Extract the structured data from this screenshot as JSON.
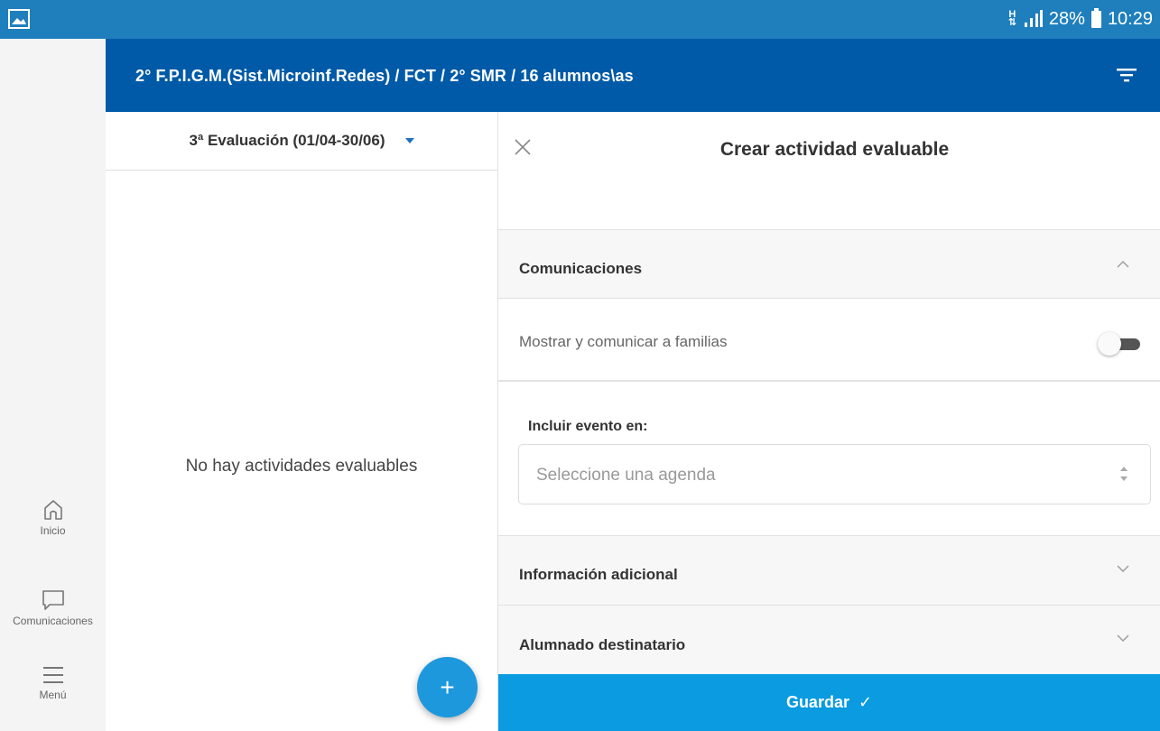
{
  "status_bar": {
    "network_type": "H",
    "battery_percent": "28%",
    "time": "10:29"
  },
  "header": {
    "title": "2° F.P.I.G.M.(Sist.Microinf.Redes) / FCT / 2° SMR / 16 alumnos\\as",
    "filter_icon": "filter-icon"
  },
  "rail": {
    "items": [
      {
        "label": "Inicio",
        "icon": "home-icon"
      },
      {
        "label": "Comunicaciones",
        "icon": "chat-icon"
      },
      {
        "label": "Menú",
        "icon": "menu-icon"
      }
    ]
  },
  "left_panel": {
    "period_selected": "3ª Evaluación (01/04-30/06)",
    "empty_message": "No hay actividades evaluables",
    "fab_label": "+"
  },
  "dialog": {
    "title": "Crear actividad evaluable",
    "sections": {
      "comunicaciones": "Comunicaciones",
      "informacion_adicional": "Información adicional",
      "alumnado_destinatario": "Alumnado destinatario"
    },
    "toggle_label": "Mostrar y comunicar a familias",
    "toggle_on": false,
    "include_label": "Incluir evento en:",
    "agenda_placeholder": "Seleccione una agenda",
    "save_label": "Guardar",
    "save_icon": "✓"
  },
  "colors": {
    "status_bar": "#1f7fbd",
    "header": "#005aa7",
    "save_bar": "#0a9be0",
    "fab": "#1d98dd"
  }
}
